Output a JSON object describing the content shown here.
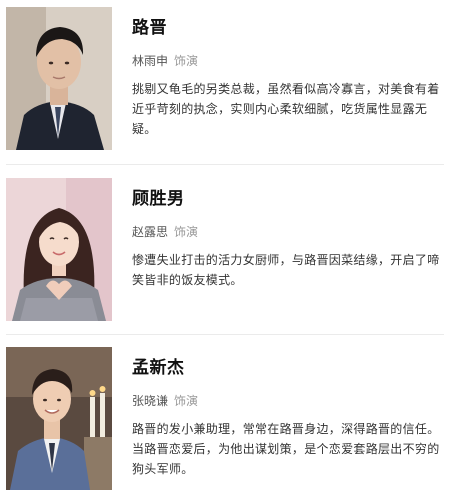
{
  "cast": [
    {
      "role": "路晋",
      "actor": "林雨申",
      "actor_suffix": "饰演",
      "description": "挑剔又龟毛的另类总裁，虽然看似高冷寡言，对美食有着近乎苛刻的执念，实则内心柔软细腻，吃货属性显露无疑。"
    },
    {
      "role": "顾胜男",
      "actor": "赵露思",
      "actor_suffix": "饰演",
      "description": "惨遭失业打击的活力女厨师，与路晋因菜结缘，开启了啼笑皆非的饭友模式。"
    },
    {
      "role": "孟新杰",
      "actor": "张晓谦",
      "actor_suffix": "饰演",
      "description": "路晋的发小兼助理，常常在路晋身边，深得路晋的信任。当路晋恋爱后，为他出谋划策，是个恋爱套路层出不穷的狗头军师。"
    }
  ]
}
